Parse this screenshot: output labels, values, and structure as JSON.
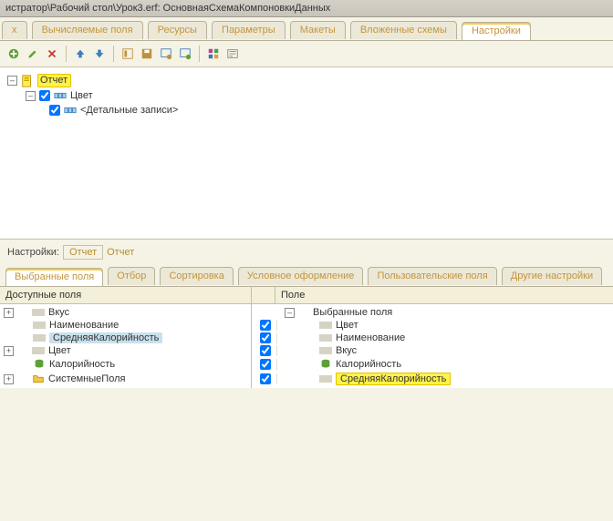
{
  "titlebar": "истратор\\Рабочий стол\\Урок3.erf: ОсновнаяСхемаКомпоновкиДанных",
  "topTabs": [
    {
      "label": "x"
    },
    {
      "label": "Вычисляемые поля"
    },
    {
      "label": "Ресурсы"
    },
    {
      "label": "Параметры"
    },
    {
      "label": "Макеты"
    },
    {
      "label": "Вложенные схемы"
    },
    {
      "label": "Настройки",
      "active": true
    }
  ],
  "tree": {
    "root": "Отчет",
    "child1": "Цвет",
    "child2": "<Детальные записи>"
  },
  "settingsRow": {
    "label": "Настройки:",
    "btn": "Отчет",
    "trail": "Отчет"
  },
  "subTabs": [
    {
      "label": "Выбранные поля",
      "active": true
    },
    {
      "label": "Отбор"
    },
    {
      "label": "Сортировка"
    },
    {
      "label": "Условное оформление"
    },
    {
      "label": "Пользовательские поля"
    },
    {
      "label": "Другие настройки"
    }
  ],
  "leftHead": "Доступные поля",
  "rightHead": "Поле",
  "available": [
    {
      "label": "Вкус",
      "icon": "bar"
    },
    {
      "label": "Наименование",
      "icon": "bar"
    },
    {
      "label": "СредняяКалорийность",
      "icon": "bar",
      "selected": true
    },
    {
      "label": "Цвет",
      "icon": "bar"
    },
    {
      "label": "Калорийность",
      "icon": "green"
    },
    {
      "label": "СистемныеПоля",
      "icon": "folder"
    }
  ],
  "rightRoot": "Выбранные поля",
  "selected": [
    {
      "label": "Цвет"
    },
    {
      "label": "Наименование"
    },
    {
      "label": "Вкус"
    },
    {
      "label": "Калорийность"
    },
    {
      "label": "СредняяКалорийность",
      "hl": true
    }
  ]
}
